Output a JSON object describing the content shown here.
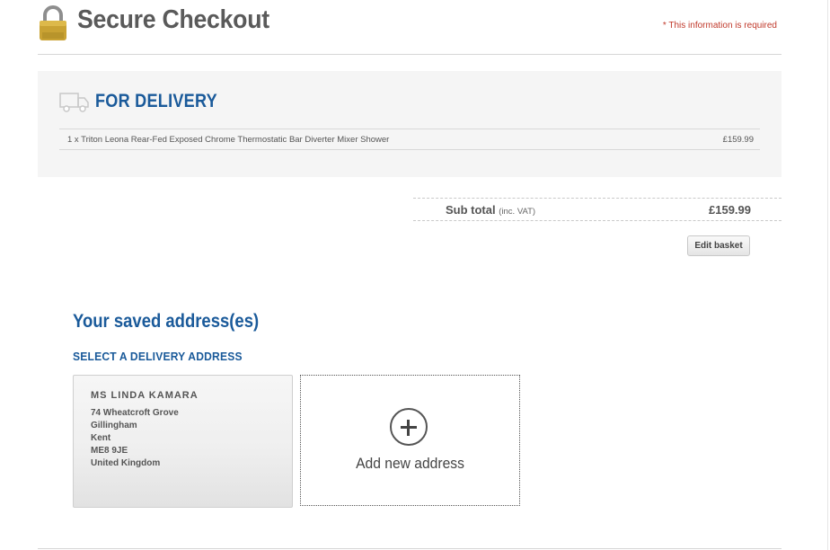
{
  "header": {
    "title": "Secure Checkout",
    "required_note": "* This information is required"
  },
  "delivery": {
    "title": "FOR DELIVERY",
    "items": [
      {
        "description": "1 x Triton Leona Rear-Fed Exposed Chrome Thermostatic Bar Diverter Mixer Shower",
        "price": "£159.99"
      }
    ]
  },
  "summary": {
    "subtotal_label": "Sub total",
    "vat_note": "(inc. VAT)",
    "subtotal_value": "£159.99",
    "edit_basket_label": "Edit basket"
  },
  "addresses": {
    "heading": "Your saved address(es)",
    "select_heading": "SELECT A DELIVERY ADDRESS",
    "saved": [
      {
        "name": "MS  LINDA  KAMARA",
        "lines": [
          "74 Wheatcroft Grove",
          "Gillingham",
          "Kent",
          "ME8 9JE",
          "United Kingdom"
        ]
      }
    ],
    "add_label": "Add new address"
  },
  "colors": {
    "accent": "#1a5a9a",
    "required": "#c0392b",
    "lock": "#c9a233"
  },
  "icons": [
    "padlock-icon",
    "delivery-truck-icon",
    "plus-circle-icon"
  ]
}
